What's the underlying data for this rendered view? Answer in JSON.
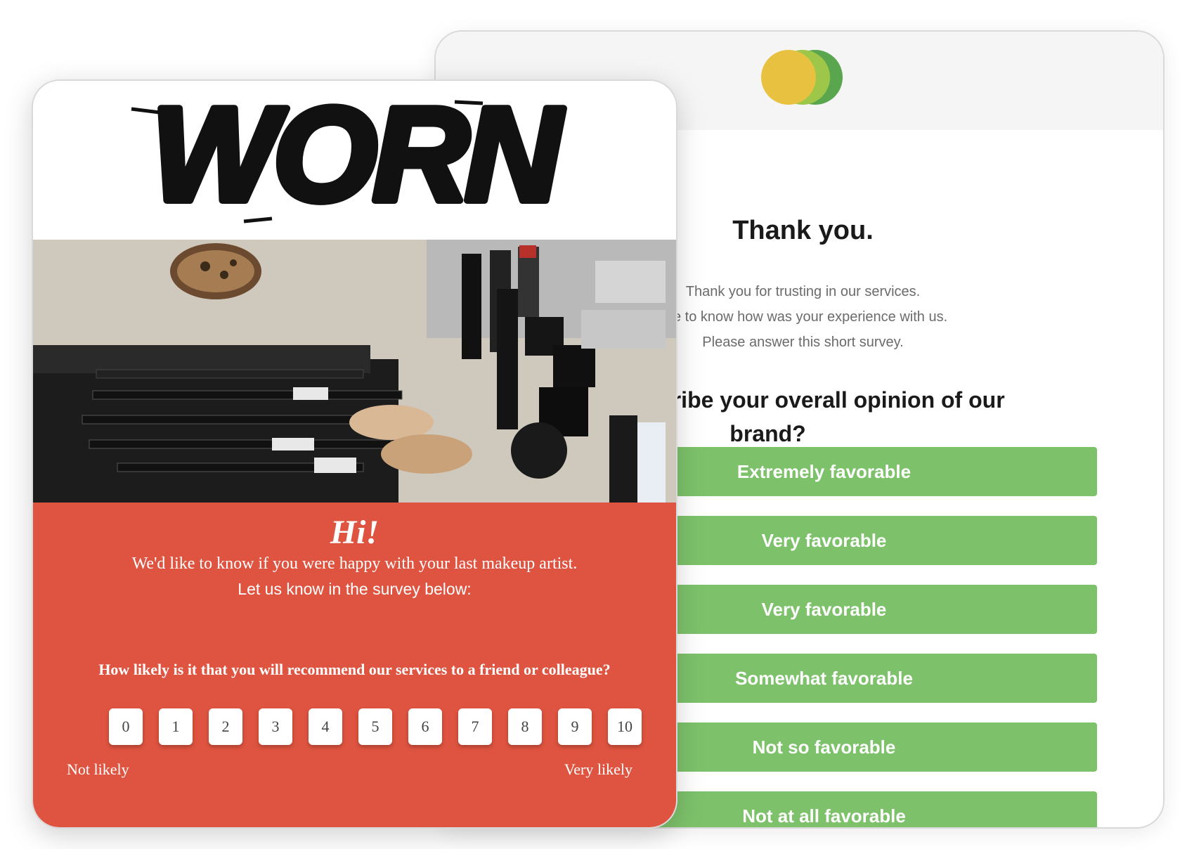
{
  "survey": {
    "title": "Thank you.",
    "intro_lines": [
      "Thank you for trusting in our services.",
      "ove to know how was your experience with us.",
      "Please answer this short survey."
    ],
    "question_line1": "u describe your overall opinion of our",
    "question_line2": "brand?",
    "options": [
      "Extremely favorable",
      "Very favorable",
      "Very favorable",
      "Somewhat favorable",
      "Not so favorable",
      "Not at all favorable"
    ],
    "colors": {
      "option_bg": "#7dc26b",
      "logo": [
        "#e8c140",
        "#9ec74a",
        "#5aa64f"
      ]
    }
  },
  "nps": {
    "brand": "WORN",
    "greeting": "Hi!",
    "line1": "We'd like to know if you were happy with your last makeup artist.",
    "line2": "Let us know in the survey below:",
    "question": "How likely is it that you will recommend our services to a friend or colleague?",
    "scale": [
      "0",
      "1",
      "2",
      "3",
      "4",
      "5",
      "6",
      "7",
      "8",
      "9",
      "10"
    ],
    "label_low": "Not likely",
    "label_high": "Very likely",
    "colors": {
      "panel_bg": "#df5440"
    },
    "photo_icon": "makeup-photo"
  }
}
